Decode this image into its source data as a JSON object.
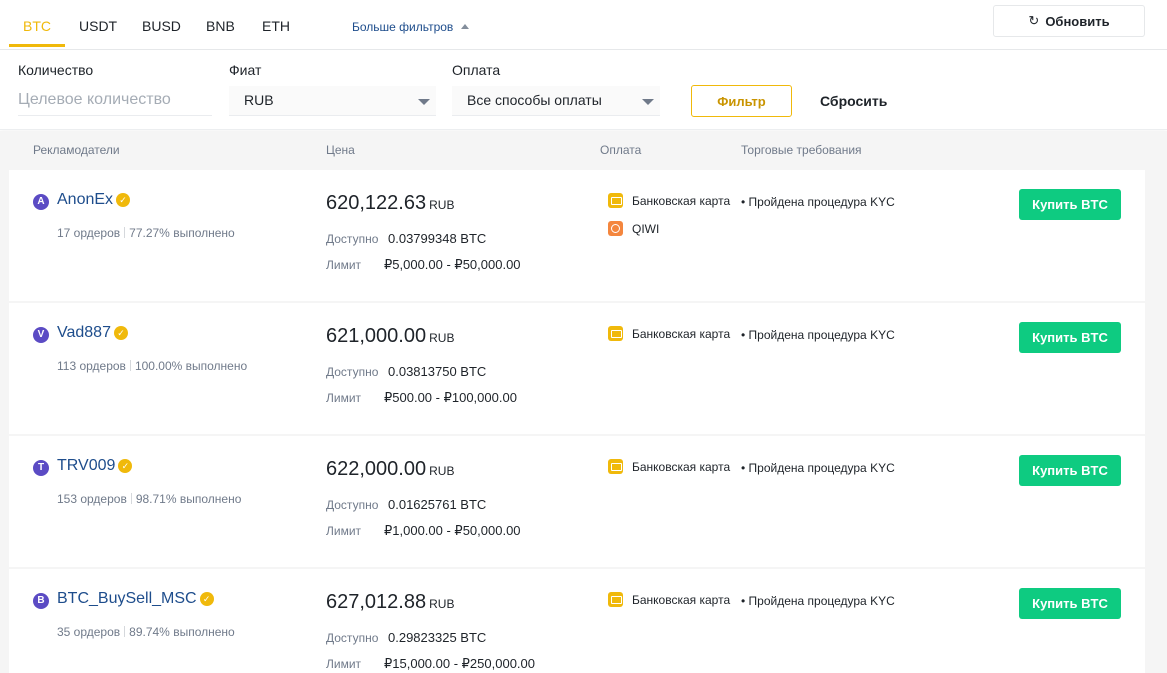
{
  "tabs": [
    {
      "label": "BTC",
      "active": true
    },
    {
      "label": "USDT",
      "active": false
    },
    {
      "label": "BUSD",
      "active": false
    },
    {
      "label": "BNB",
      "active": false
    },
    {
      "label": "ETH",
      "active": false
    }
  ],
  "more_filters_label": "Больше фильтров",
  "refresh_label": "Обновить",
  "filters": {
    "amount_label": "Количество",
    "amount_placeholder": "Целевое количество",
    "fiat_label": "Фиат",
    "fiat_value": "RUB",
    "payment_label": "Оплата",
    "payment_value": "Все способы оплаты",
    "filter_button": "Фильтр",
    "reset_button": "Сбросить"
  },
  "table_headers": {
    "advertisers": "Рекламодатели",
    "price": "Цена",
    "payment": "Оплата",
    "requirements": "Торговые требования"
  },
  "labels": {
    "available": "Доступно",
    "limit": "Лимит"
  },
  "offers": [
    {
      "initial": "A",
      "name": "AnonEx",
      "orders": "17 ордеров",
      "completion": "77.27% выполнено",
      "price": "620,122.63",
      "currency": "RUB",
      "available": "0.03799348 BTC",
      "limit": "₽5,000.00 - ₽50,000.00",
      "payments": [
        {
          "name": "Банковская карта",
          "icon": "bank-card-icon"
        },
        {
          "name": "QIWI",
          "icon": "qiwi-icon"
        }
      ],
      "requirement": "• Пройдена процедура KYC",
      "buy_label": "Купить BTC"
    },
    {
      "initial": "V",
      "name": "Vad887",
      "orders": "113 ордеров",
      "completion": "100.00% выполнено",
      "price": "621,000.00",
      "currency": "RUB",
      "available": "0.03813750 BTC",
      "limit": "₽500.00 - ₽100,000.00",
      "payments": [
        {
          "name": "Банковская карта",
          "icon": "bank-card-icon"
        }
      ],
      "requirement": "• Пройдена процедура KYC",
      "buy_label": "Купить BTC"
    },
    {
      "initial": "T",
      "name": "TRV009",
      "orders": "153 ордеров",
      "completion": "98.71% выполнено",
      "price": "622,000.00",
      "currency": "RUB",
      "available": "0.01625761 BTC",
      "limit": "₽1,000.00 - ₽50,000.00",
      "payments": [
        {
          "name": "Банковская карта",
          "icon": "bank-card-icon"
        }
      ],
      "requirement": "• Пройдена процедура KYC",
      "buy_label": "Купить BTC"
    },
    {
      "initial": "B",
      "name": "BTC_BuySell_MSC",
      "orders": "35 ордеров",
      "completion": "89.74% выполнено",
      "price": "627,012.88",
      "currency": "RUB",
      "available": "0.29823325 BTC",
      "limit": "₽15,000.00 - ₽250,000.00",
      "payments": [
        {
          "name": "Банковская карта",
          "icon": "bank-card-icon"
        }
      ],
      "requirement": "• Пройдена процедура KYC",
      "buy_label": "Купить BTC"
    }
  ],
  "colors": {
    "accent": "#f0b90b",
    "buy": "#0ecb81",
    "link": "#1e4d8c",
    "avatar": "#5b4bc4"
  }
}
